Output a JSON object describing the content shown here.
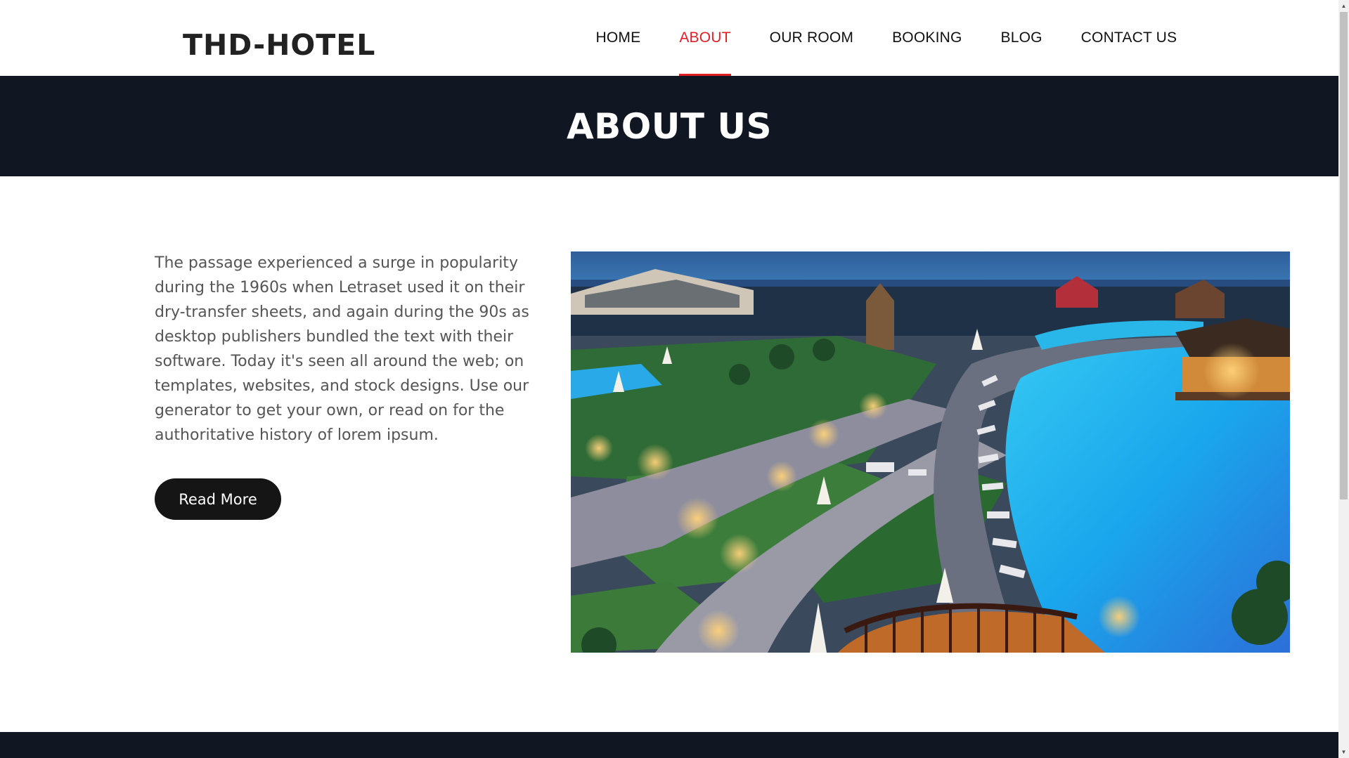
{
  "header": {
    "logo": "THD-HOTEL",
    "nav": [
      {
        "label": "HOME",
        "active": false
      },
      {
        "label": "ABOUT",
        "active": true
      },
      {
        "label": "OUR ROOM",
        "active": false
      },
      {
        "label": "BOOKING",
        "active": false
      },
      {
        "label": "BLOG",
        "active": false
      },
      {
        "label": "CONTACT US",
        "active": false
      }
    ]
  },
  "banner": {
    "title": "ABOUT US"
  },
  "about": {
    "text": "The passage experienced a surge in popularity during the 1960s when Letraset used it on their dry-transfer sheets, and again during the 90s as desktop publishers bundled the text with their software. Today it's seen all around the web; on templates, websites, and stock designs. Use our generator to get your own, or read on for the authoritative history of lorem ipsum.",
    "button_label": "Read More",
    "image_icon": "resort-pool-photo"
  },
  "colors": {
    "accent": "#e31f26",
    "dark_band": "#111722",
    "button_bg": "#151515"
  }
}
